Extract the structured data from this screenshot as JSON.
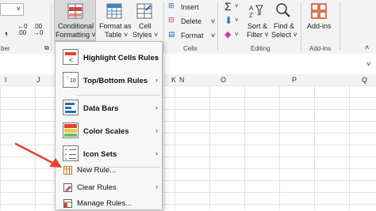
{
  "ribbon": {
    "number_group_label": "ber",
    "number_format_value": "",
    "buttons": {
      "conditional_formatting_line1": "Conditional",
      "conditional_formatting_line2": "Formatting ˅",
      "format_as_table_line1": "Format as",
      "format_as_table_line2": "Table ˅",
      "cell_styles_line1": "Cell",
      "cell_styles_line2": "Styles ˅",
      "insert": "Insert",
      "delete": "Delete",
      "format": "Format",
      "sort_filter_line1": "Sort &",
      "sort_filter_line2": "Filter ˅",
      "find_select_line1": "Find &",
      "find_select_line2": "Select ˅",
      "addins": "Add-ins"
    },
    "group_labels": {
      "cells": "Cells",
      "editing": "Editing",
      "addins": "Add-ins"
    },
    "accent_color": "#217346"
  },
  "columns": [
    "I",
    "J",
    "K",
    "N",
    "O",
    "P",
    "Q"
  ],
  "menu": {
    "items": [
      {
        "label": "Highlight Cells Rules",
        "has_submenu": true,
        "icon": "highlight-cells-icon"
      },
      {
        "label": "Top/Bottom Rules",
        "has_submenu": true,
        "icon": "top-bottom-icon"
      },
      {
        "label": "Data Bars",
        "has_submenu": true,
        "icon": "data-bars-icon"
      },
      {
        "label": "Color Scales",
        "has_submenu": true,
        "icon": "color-scales-icon"
      },
      {
        "label": "Icon Sets",
        "has_submenu": true,
        "icon": "icon-sets-icon"
      },
      {
        "label": "New Rule...",
        "has_submenu": false,
        "icon": "new-rule-icon"
      },
      {
        "label": "Clear Rules",
        "has_submenu": true,
        "icon": "clear-rules-icon"
      },
      {
        "label": "Manage Rules...",
        "has_submenu": false,
        "icon": "manage-rules-icon"
      }
    ]
  },
  "annotation": {
    "color": "#e8412c",
    "icon": "red-arrow"
  }
}
